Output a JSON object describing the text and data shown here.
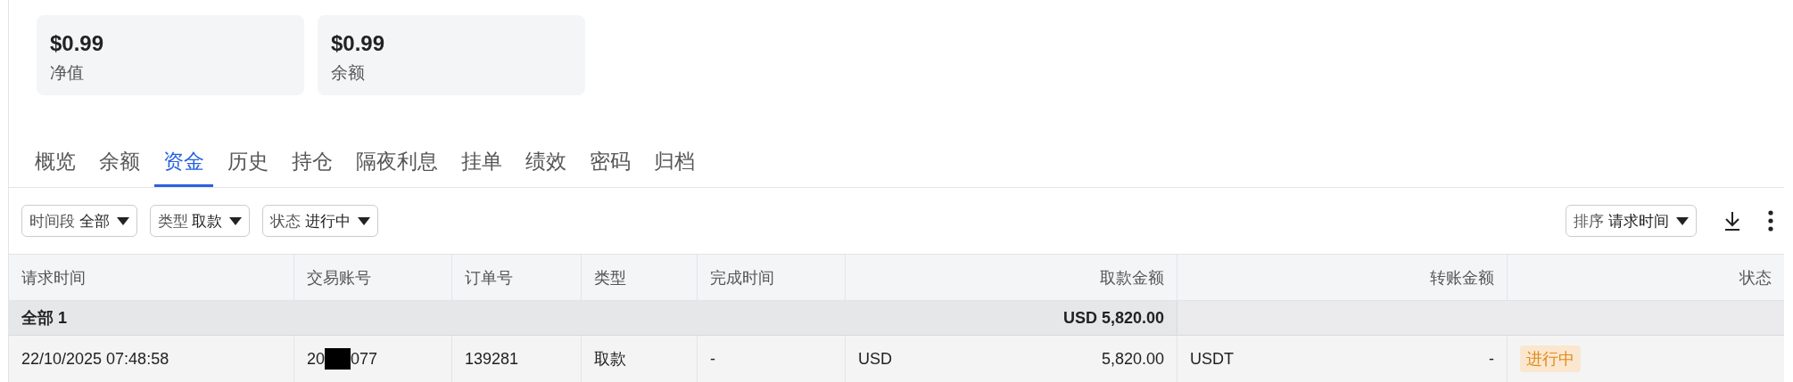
{
  "cards": [
    {
      "value": "$0.99",
      "label": "净值"
    },
    {
      "value": "$0.99",
      "label": "余额"
    }
  ],
  "tabs": [
    {
      "label": "概览",
      "selected": false
    },
    {
      "label": "余额",
      "selected": false
    },
    {
      "label": "资金",
      "selected": true
    },
    {
      "label": "历史",
      "selected": false
    },
    {
      "label": "持仓",
      "selected": false
    },
    {
      "label": "隔夜利息",
      "selected": false
    },
    {
      "label": "挂单",
      "selected": false
    },
    {
      "label": "绩效",
      "selected": false
    },
    {
      "label": "密码",
      "selected": false
    },
    {
      "label": "归档",
      "selected": false
    }
  ],
  "filters": [
    {
      "label": "时间段",
      "value": "全部"
    },
    {
      "label": "类型",
      "value": "取款"
    },
    {
      "label": "状态",
      "value": "进行中"
    }
  ],
  "sort": {
    "label": "排序",
    "value": "请求时间"
  },
  "table": {
    "columns": [
      "请求时间",
      "交易账号",
      "订单号",
      "类型",
      "完成时间",
      "取款金额",
      "转账金额",
      "状态"
    ],
    "total": {
      "label": "全部 1",
      "amount": "USD 5,820.00"
    },
    "rows": [
      {
        "request_time": "22/10/2025 07:48:58",
        "account_start": "20",
        "account_end": "077",
        "order": "139281",
        "type": "取款",
        "completed": "-",
        "withdraw_currency": "USD",
        "withdraw_amount": "5,820.00",
        "transfer_currency": "USDT",
        "transfer_amount": "-",
        "status": "进行中"
      }
    ]
  }
}
